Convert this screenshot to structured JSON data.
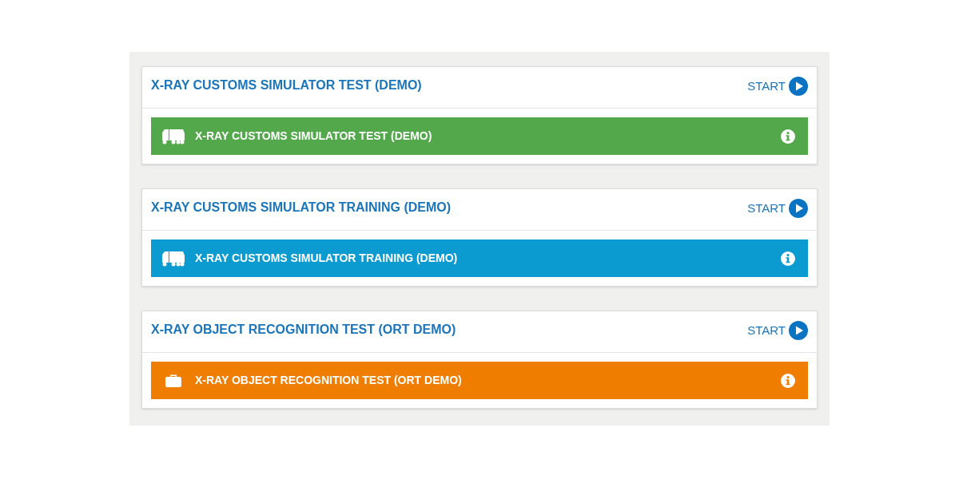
{
  "tests": [
    {
      "title": "X-RAY CUSTOMS SIMULATOR TEST (DEMO)",
      "start": "START",
      "bar": {
        "label": "X-RAY CUSTOMS SIMULATOR TEST (DEMO)",
        "color": "#53a84b",
        "kind": "truck"
      }
    },
    {
      "title": "X-RAY CUSTOMS SIMULATOR TRAINING (DEMO)",
      "start": "START",
      "bar": {
        "label": "X-RAY CUSTOMS SIMULATOR TRAINING (DEMO)",
        "color": "#0b9bd1",
        "kind": "truck"
      }
    },
    {
      "title": "X-RAY OBJECT RECOGNITION TEST (ORT DEMO)",
      "start": "START",
      "bar": {
        "label": "X-RAY OBJECT RECOGNITION TEST (ORT DEMO)",
        "color": "#ef7d00",
        "kind": "briefcase"
      }
    }
  ]
}
